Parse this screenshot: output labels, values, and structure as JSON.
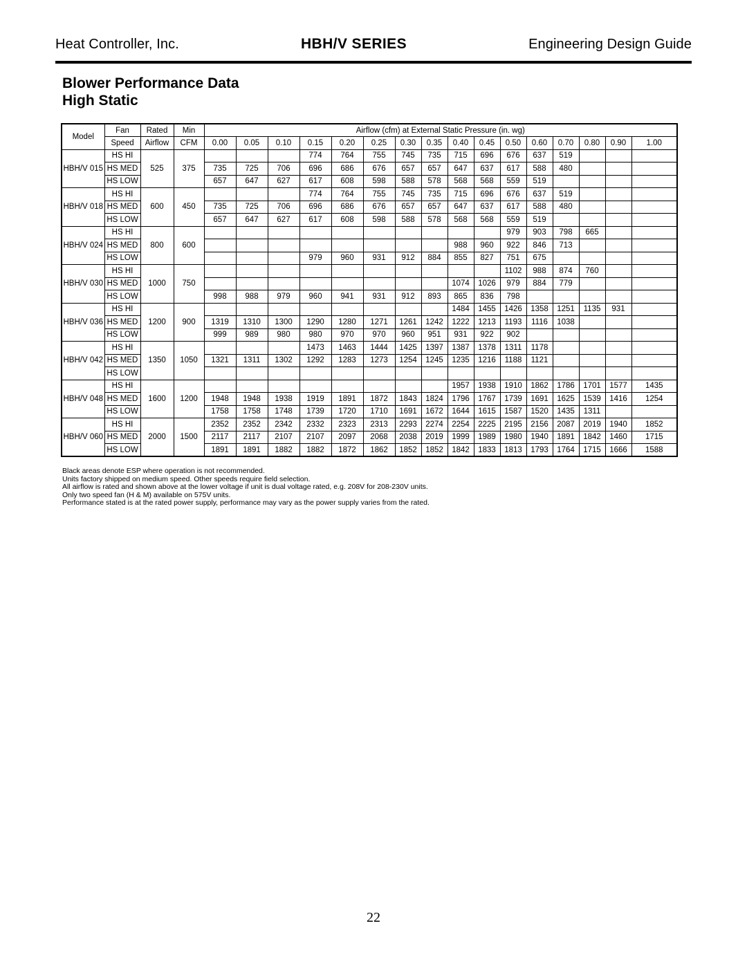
{
  "header": {
    "left": "Heat Controller, Inc.",
    "center": "HBH/V SERIES",
    "right": "Engineering Design Guide"
  },
  "title": {
    "line1": "Blower Performance Data",
    "line2": "High Static"
  },
  "table": {
    "headers": {
      "model": "Model",
      "fan": "Fan",
      "speed": "Speed",
      "rated": "Rated",
      "airflow": "Airflow",
      "min": "Min",
      "cfm": "CFM",
      "pressure_group": "Airflow (cfm) at External Static Pressure (in. wg)"
    },
    "pressure_columns": [
      "0.00",
      "0.05",
      "0.10",
      "0.15",
      "0.20",
      "0.25",
      "0.30",
      "0.35",
      "0.40",
      "0.45",
      "0.50",
      "0.60",
      "0.70",
      "0.80",
      "0.90",
      "1.00"
    ],
    "speed_labels": [
      "HS HI",
      "HS MED",
      "HS LOW"
    ],
    "rows": [
      {
        "model": "HBH/V 015",
        "rated_airflow": "525",
        "min_cfm": "375",
        "speeds": [
          {
            "label": "HS HI",
            "values": [
              "",
              "",
              "",
              "774",
              "764",
              "755",
              "745",
              "735",
              "715",
              "696",
              "676",
              "637",
              "519",
              "",
              "",
              ""
            ]
          },
          {
            "label": "HS MED",
            "values": [
              "735",
              "725",
              "706",
              "696",
              "686",
              "676",
              "657",
              "657",
              "647",
              "637",
              "617",
              "588",
              "480",
              "",
              "",
              ""
            ]
          },
          {
            "label": "HS LOW",
            "values": [
              "657",
              "647",
              "627",
              "617",
              "608",
              "598",
              "588",
              "578",
              "568",
              "568",
              "559",
              "519",
              "",
              "",
              "",
              ""
            ]
          }
        ]
      },
      {
        "model": "HBH/V 018",
        "rated_airflow": "600",
        "min_cfm": "450",
        "speeds": [
          {
            "label": "HS HI",
            "values": [
              "",
              "",
              "",
              "774",
              "764",
              "755",
              "745",
              "735",
              "715",
              "696",
              "676",
              "637",
              "519",
              "",
              "",
              ""
            ]
          },
          {
            "label": "HS MED",
            "values": [
              "735",
              "725",
              "706",
              "696",
              "686",
              "676",
              "657",
              "657",
              "647",
              "637",
              "617",
              "588",
              "480",
              "",
              "",
              ""
            ]
          },
          {
            "label": "HS LOW",
            "values": [
              "657",
              "647",
              "627",
              "617",
              "608",
              "598",
              "588",
              "578",
              "568",
              "568",
              "559",
              "519",
              "",
              "",
              "",
              ""
            ]
          }
        ]
      },
      {
        "model": "HBH/V 024",
        "rated_airflow": "800",
        "min_cfm": "600",
        "speeds": [
          {
            "label": "HS HI",
            "values": [
              "",
              "",
              "",
              "",
              "",
              "",
              "",
              "",
              "",
              "",
              "979",
              "903",
              "798",
              "665",
              "",
              ""
            ]
          },
          {
            "label": "HS MED",
            "values": [
              "",
              "",
              "",
              "",
              "",
              "",
              "",
              "",
              "988",
              "960",
              "922",
              "846",
              "713",
              "",
              "",
              ""
            ]
          },
          {
            "label": "HS LOW",
            "values": [
              "",
              "",
              "",
              "979",
              "960",
              "931",
              "912",
              "884",
              "855",
              "827",
              "751",
              "675",
              "",
              "",
              "",
              ""
            ]
          }
        ]
      },
      {
        "model": "HBH/V 030",
        "rated_airflow": "1000",
        "min_cfm": "750",
        "speeds": [
          {
            "label": "HS HI",
            "values": [
              "",
              "",
              "",
              "",
              "",
              "",
              "",
              "",
              "",
              "",
              "1102",
              "988",
              "874",
              "760",
              "",
              ""
            ]
          },
          {
            "label": "HS MED",
            "values": [
              "",
              "",
              "",
              "",
              "",
              "",
              "",
              "",
              "1074",
              "1026",
              "979",
              "884",
              "779",
              "",
              "",
              ""
            ]
          },
          {
            "label": "HS LOW",
            "values": [
              "998",
              "988",
              "979",
              "960",
              "941",
              "931",
              "912",
              "893",
              "865",
              "836",
              "798",
              "",
              "",
              "",
              "",
              ""
            ]
          }
        ]
      },
      {
        "model": "HBH/V 036",
        "rated_airflow": "1200",
        "min_cfm": "900",
        "speeds": [
          {
            "label": "HS HI",
            "values": [
              "",
              "",
              "",
              "",
              "",
              "",
              "",
              "",
              "1484",
              "1455",
              "1426",
              "1358",
              "1251",
              "1135",
              "931",
              ""
            ]
          },
          {
            "label": "HS MED",
            "values": [
              "1319",
              "1310",
              "1300",
              "1290",
              "1280",
              "1271",
              "1261",
              "1242",
              "1222",
              "1213",
              "1193",
              "1116",
              "1038",
              "",
              "",
              ""
            ]
          },
          {
            "label": "HS LOW",
            "values": [
              "999",
              "989",
              "980",
              "980",
              "970",
              "970",
              "960",
              "951",
              "931",
              "922",
              "902",
              "",
              "",
              "",
              "",
              ""
            ]
          }
        ]
      },
      {
        "model": "HBH/V 042",
        "rated_airflow": "1350",
        "min_cfm": "1050",
        "speeds": [
          {
            "label": "HS HI",
            "values": [
              "",
              "",
              "",
              "1473",
              "1463",
              "1444",
              "1425",
              "1397",
              "1387",
              "1378",
              "1311",
              "1178",
              "",
              "",
              "",
              ""
            ]
          },
          {
            "label": "HS MED",
            "values": [
              "1321",
              "1311",
              "1302",
              "1292",
              "1283",
              "1273",
              "1254",
              "1245",
              "1235",
              "1216",
              "1188",
              "1121",
              "",
              "",
              "",
              ""
            ]
          },
          {
            "label": "HS LOW",
            "values": [
              "",
              "",
              "",
              "",
              "",
              "",
              "",
              "",
              "",
              "",
              "",
              "",
              "",
              "",
              "",
              ""
            ]
          }
        ]
      },
      {
        "model": "HBH/V 048",
        "rated_airflow": "1600",
        "min_cfm": "1200",
        "speeds": [
          {
            "label": "HS HI",
            "values": [
              "",
              "",
              "",
              "",
              "",
              "",
              "",
              "",
              "1957",
              "1938",
              "1910",
              "1862",
              "1786",
              "1701",
              "1577",
              "1435"
            ]
          },
          {
            "label": "HS MED",
            "values": [
              "1948",
              "1948",
              "1938",
              "1919",
              "1891",
              "1872",
              "1843",
              "1824",
              "1796",
              "1767",
              "1739",
              "1691",
              "1625",
              "1539",
              "1416",
              "1254"
            ]
          },
          {
            "label": "HS LOW",
            "values": [
              "1758",
              "1758",
              "1748",
              "1739",
              "1720",
              "1710",
              "1691",
              "1672",
              "1644",
              "1615",
              "1587",
              "1520",
              "1435",
              "1311",
              "",
              ""
            ]
          }
        ]
      },
      {
        "model": "HBH/V 060",
        "rated_airflow": "2000",
        "min_cfm": "1500",
        "speeds": [
          {
            "label": "HS HI",
            "values": [
              "2352",
              "2352",
              "2342",
              "2332",
              "2323",
              "2313",
              "2293",
              "2274",
              "2254",
              "2225",
              "2195",
              "2156",
              "2087",
              "2019",
              "1940",
              "1852"
            ]
          },
          {
            "label": "HS MED",
            "values": [
              "2117",
              "2117",
              "2107",
              "2107",
              "2097",
              "2068",
              "2038",
              "2019",
              "1999",
              "1989",
              "1980",
              "1940",
              "1891",
              "1842",
              "1460",
              "1715"
            ]
          },
          {
            "label": "HS LOW",
            "values": [
              "1891",
              "1891",
              "1882",
              "1882",
              "1872",
              "1862",
              "1852",
              "1852",
              "1842",
              "1833",
              "1813",
              "1793",
              "1764",
              "1715",
              "1666",
              "1588"
            ]
          }
        ]
      }
    ]
  },
  "footnotes": [
    "Black areas denote ESP where operation is not recommended.",
    "Units factory shipped on medium speed.  Other speeds require field selection.",
    "All airflow is rated and shown above at the lower voltage if unit is dual voltage rated, e.g. 208V for 208-230V units.",
    "Only two speed fan (H & M) available on 575V units.",
    "Performance stated is at the rated power supply, performance may vary as the power supply varies from the rated."
  ],
  "page_number": "22",
  "colors": {
    "header_fill": "#c5d9f1",
    "blocked_fill": "#000000"
  }
}
